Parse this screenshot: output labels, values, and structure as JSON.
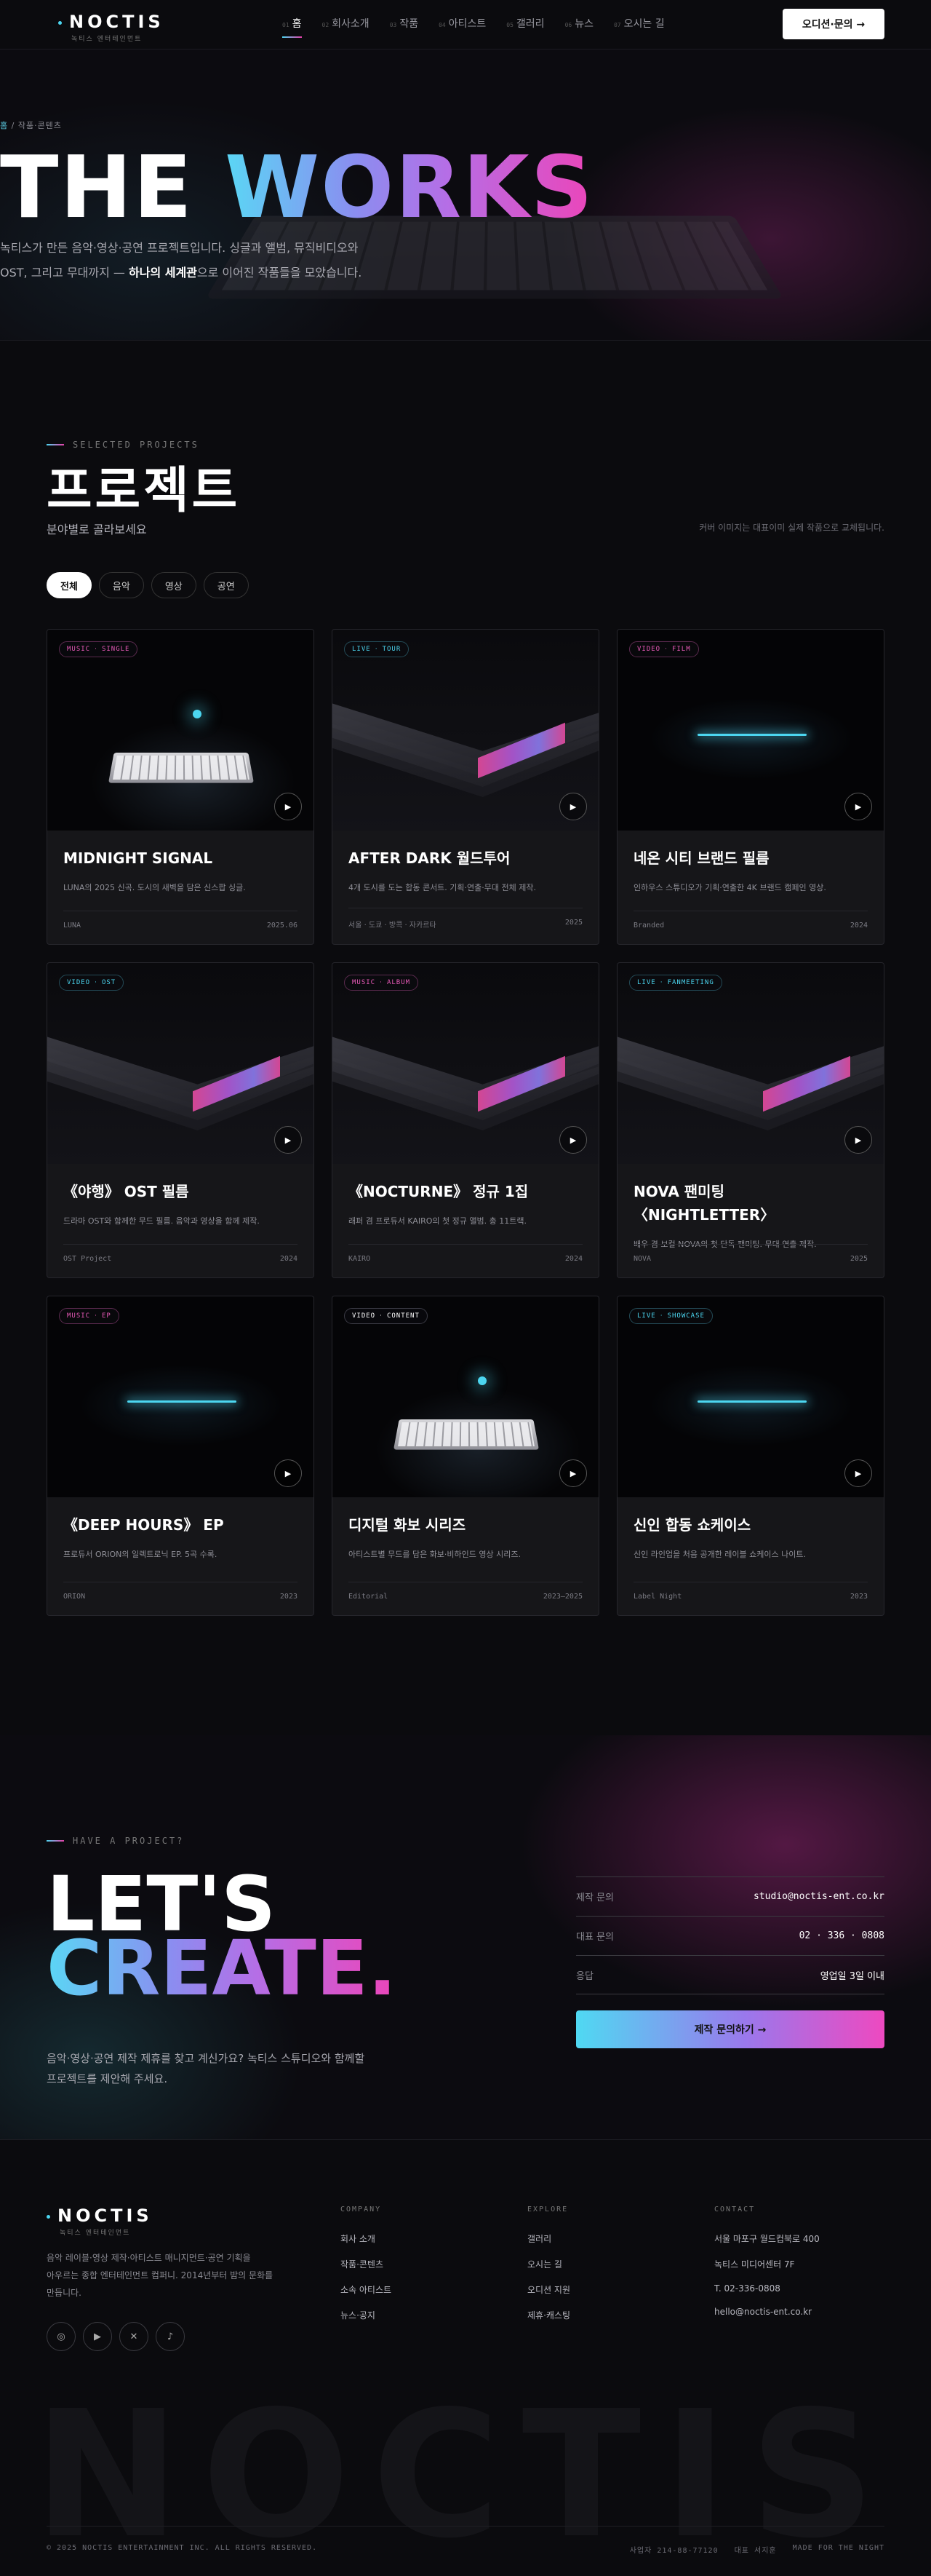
{
  "header": {
    "logo": "NOCTIS",
    "logo_sub": "녹티스 엔터테인먼트",
    "nav": [
      {
        "num": "01",
        "label": "홈"
      },
      {
        "num": "02",
        "label": "회사소개"
      },
      {
        "num": "03",
        "label": "작품"
      },
      {
        "num": "04",
        "label": "아티스트"
      },
      {
        "num": "05",
        "label": "갤러리"
      },
      {
        "num": "06",
        "label": "뉴스"
      },
      {
        "num": "07",
        "label": "오시는 길"
      }
    ],
    "cta": "오디션·문의 →"
  },
  "hero": {
    "crumb_home": "홈",
    "crumb_rest": " / 작품·콘텐츠",
    "title_1": "THE ",
    "title_2": "WORKS",
    "desc_1": "녹티스가 만든 음악·영상·공연 프로젝트입니다. 싱글과 앨범, 뮤직비디오와",
    "desc_2a": "OST, 그리고 무대까지 — ",
    "desc_2b": "하나의 세계관",
    "desc_2c": "으로 이어진 작품들을 모았습니다."
  },
  "projects": {
    "eyebrow": "SELECTED PROJECTS",
    "title": "프로젝트",
    "subtitle": "분야별로 골라보세요",
    "note": "커버 이미지는 대표이미 실제 작품으로 교체됩니다.",
    "filters": [
      "전체",
      "음악",
      "영상",
      "공연"
    ],
    "cards": [
      {
        "tag1": "MUSIC",
        "tag2": "SINGLE",
        "title": "MIDNIGHT SIGNAL",
        "desc": "LUNA의 2025 신곡. 도시의 새벽을 담은 신스팝 싱글.",
        "left": "LUNA",
        "right": "2025.06"
      },
      {
        "tag1": "LIVE",
        "tag2": "TOUR",
        "title": "AFTER DARK 월드투어",
        "desc": "4개 도시를 도는 합동 콘서트. 기획·연출·무대 전체 제작.",
        "left": "서울 · 도쿄 · 방콕 · 자카르타",
        "right": "2025"
      },
      {
        "tag1": "VIDEO",
        "tag2": "FILM",
        "title": "네온 시티 브랜드 필름",
        "desc": "인하우스 스튜디오가 기획·연출한 4K 브랜드 캠페인 영상.",
        "left": "Branded",
        "right": "2024"
      },
      {
        "tag1": "VIDEO",
        "tag2": "OST",
        "title": "《야행》 OST 필름",
        "desc": "드라마 OST와 함께한 무드 필름. 음악과 영상을 함께 제작.",
        "left": "OST Project",
        "right": "2024"
      },
      {
        "tag1": "MUSIC",
        "tag2": "ALBUM",
        "title": "《NOCTURNE》 정규 1집",
        "desc": "래퍼 겸 프로듀서 KAIRO의 첫 정규 앨범. 총 11트랙.",
        "left": "KAIRO",
        "right": "2024"
      },
      {
        "tag1": "LIVE",
        "tag2": "FANMEETING",
        "title": "NOVA 팬미팅 〈NIGHTLETTER〉",
        "desc": "배우 겸 보컬 NOVA의 첫 단독 팬미팅. 무대 연출 제작.",
        "left": "NOVA",
        "right": "2025"
      },
      {
        "tag1": "MUSIC",
        "tag2": "EP",
        "title": "《DEEP HOURS》 EP",
        "desc": "프로듀서 ORION의 일렉트로닉 EP. 5곡 수록.",
        "left": "ORION",
        "right": "2023"
      },
      {
        "tag1": "VIDEO",
        "tag2": "CONTENT",
        "title": "디지털 화보 시리즈",
        "desc": "아티스트별 무드를 담은 화보·비하인드 영상 시리즈.",
        "left": "Editorial",
        "right": "2023–2025"
      },
      {
        "tag1": "LIVE",
        "tag2": "SHOWCASE",
        "title": "신인 합동 쇼케이스",
        "desc": "신인 라인업을 처음 공개한 레이블 쇼케이스 나이트.",
        "left": "Label Night",
        "right": "2023"
      }
    ]
  },
  "cta": {
    "eyebrow": "HAVE A PROJECT?",
    "line1": "LET'S",
    "line2": "CREATE.",
    "desc_1": "음악·영상·공연 제작 제휴를 찾고 계신가요? 녹티스 스튜디오와 함께할",
    "desc_2": "프로젝트를 제안해 주세요.",
    "rows": [
      {
        "k": "제작 문의",
        "v": "studio@noctis-ent.co.kr"
      },
      {
        "k": "대표 문의",
        "v": "02 · 336 · 0808"
      },
      {
        "k": "응답",
        "v": "영업일 3일 이내"
      }
    ],
    "button": "제작 문의하기 →"
  },
  "footer": {
    "logo": "NOCTIS",
    "logo_sub": "녹티스 엔터테인먼트",
    "about_1": "음악 레이블·영상 제작·아티스트 매니지먼트·공연 기획을",
    "about_2": "아우르는 종합 엔터테인먼트 컴퍼니. 2014년부터 밤의 문화를",
    "about_3": "만듭니다.",
    "social_icons": [
      "instagram-icon",
      "youtube-icon",
      "x-icon",
      "tiktok-icon"
    ],
    "col1_title": "COMPANY",
    "col1": [
      "회사 소개",
      "작품·콘텐츠",
      "소속 아티스트",
      "뉴스·공지"
    ],
    "col2_title": "EXPLORE",
    "col2": [
      "갤러리",
      "오시는 길",
      "오디션 지원",
      "제휴·캐스팅"
    ],
    "col3_title": "CONTACT",
    "col3": [
      "서울 마포구 월드컵북로 400",
      "녹티스 미디어센터 7F",
      "T. 02-336-0808",
      "hello@noctis-ent.co.kr"
    ],
    "bigword": "NOCTIS",
    "copyright": "© 2025 NOCTIS ENTERTAINMENT INC. ALL RIGHTS RESERVED.",
    "biz": "사업자 214-88-77120",
    "ceo": "대표 서지훈",
    "made": "MADE FOR THE NIGHT"
  }
}
